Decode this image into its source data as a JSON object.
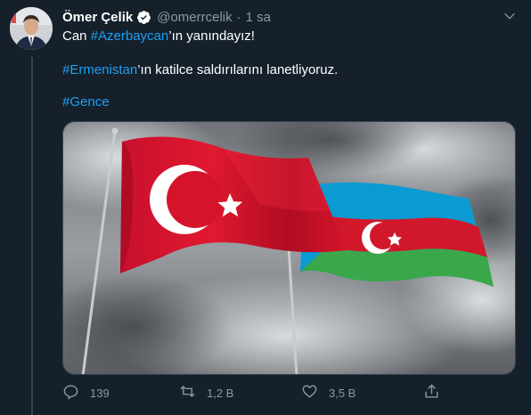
{
  "author": {
    "name": "Ömer Çelik",
    "handle": "@omerrcelik",
    "separator": "·",
    "time": "1 sa"
  },
  "tweet": {
    "line1": {
      "prefix": "Can ",
      "hashtag": "#Azerbaycan",
      "suffix": "’ın yanındayız!"
    },
    "line2": {
      "hashtag": "#Ermenistan",
      "suffix": "’ın katilce saldırılarını lanetliyoruz."
    },
    "line3": {
      "hashtag": "#Gence"
    }
  },
  "actions": {
    "reply": "139",
    "retweet": "1,2 B",
    "like": "3,5 B"
  },
  "colors": {
    "background": "#15202b",
    "accent": "#1da1f2",
    "muted": "#8899a6",
    "border": "#38444d"
  },
  "icons": [
    "verified-badge-icon",
    "chevron-down-icon",
    "reply-icon",
    "retweet-icon",
    "like-icon",
    "share-icon"
  ]
}
